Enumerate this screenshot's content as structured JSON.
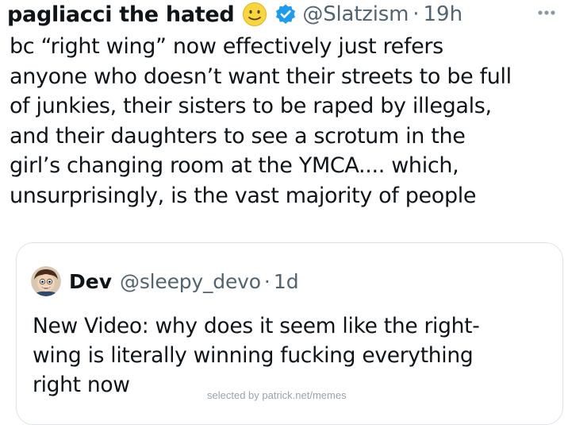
{
  "tweet": {
    "display_name": "pagliacci the hated",
    "emoji": "smiley-face-emoji",
    "verified_color": "#1d9bf0",
    "handle": "@Slatzism",
    "separator": "·",
    "time": "19h",
    "more_icon": "more-horizontal-icon",
    "body_lines": [
      "bc “right wing” now effectively just refers",
      "anyone who doesn’t want their streets to be full",
      "of junkies, their sisters to be raped by illegals,",
      "and their daughters to see a scrotum in the",
      "girl’s changing room at the YMCA.... which,",
      "unsurprisingly, is the vast majority of people"
    ]
  },
  "quoted_tweet": {
    "display_name": "Dev",
    "handle": "@sleepy_devo",
    "separator": "·",
    "time": "1d",
    "avatar": "cartoon-avatar",
    "body_lines": [
      "New Video: why does it seem like the right-",
      "wing is literally winning fucking everything",
      "right now"
    ]
  },
  "watermark": "selected by patrick.net/memes",
  "colors": {
    "text": "#0f1419",
    "secondary": "#536471",
    "border": "#dfe3e7",
    "verified": "#1d9bf0"
  }
}
